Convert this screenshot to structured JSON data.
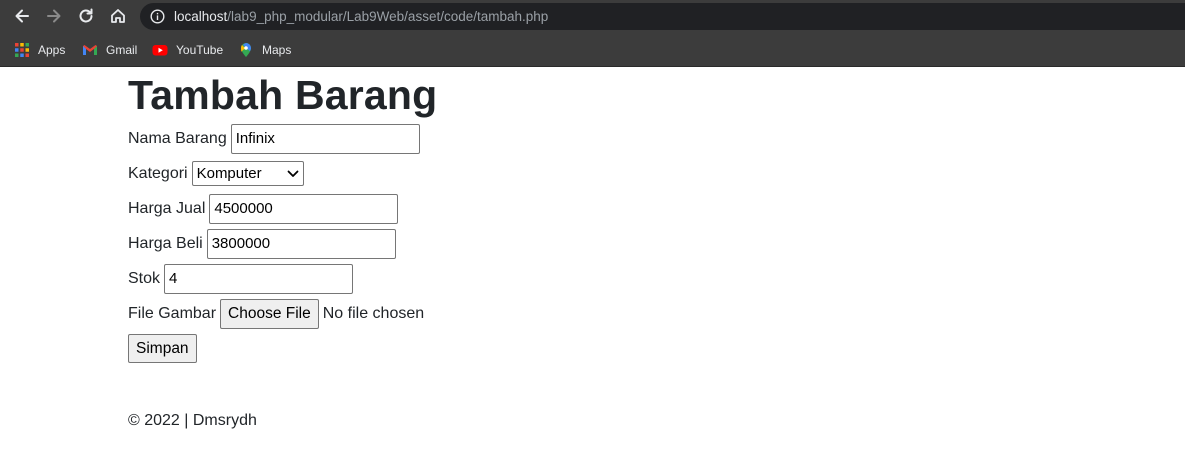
{
  "browser": {
    "url_host": "localhost",
    "url_path": "/lab9_php_modular/Lab9Web/asset/code/tambah.php",
    "bookmarks": [
      {
        "label": "Apps",
        "icon": "apps-grid-icon"
      },
      {
        "label": "Gmail",
        "icon": "gmail-icon"
      },
      {
        "label": "YouTube",
        "icon": "youtube-icon"
      },
      {
        "label": "Maps",
        "icon": "maps-icon"
      }
    ]
  },
  "page": {
    "title": "Tambah Barang",
    "form": {
      "nama_barang": {
        "label": "Nama Barang",
        "value": "Infinix"
      },
      "kategori": {
        "label": "Kategori",
        "selected": "Komputer"
      },
      "harga_jual": {
        "label": "Harga Jual",
        "value": "4500000"
      },
      "harga_beli": {
        "label": "Harga Beli",
        "value": "3800000"
      },
      "stok": {
        "label": "Stok",
        "value": "4"
      },
      "file_gambar": {
        "label": "File Gambar",
        "button": "Choose File",
        "status": "No file chosen"
      },
      "submit": "Simpan"
    },
    "footer": "© 2022 | Dmsrydh"
  },
  "colors": {
    "chrome_bg": "#3c3c3c",
    "omnibox_bg": "#202124",
    "text": "#212529"
  }
}
